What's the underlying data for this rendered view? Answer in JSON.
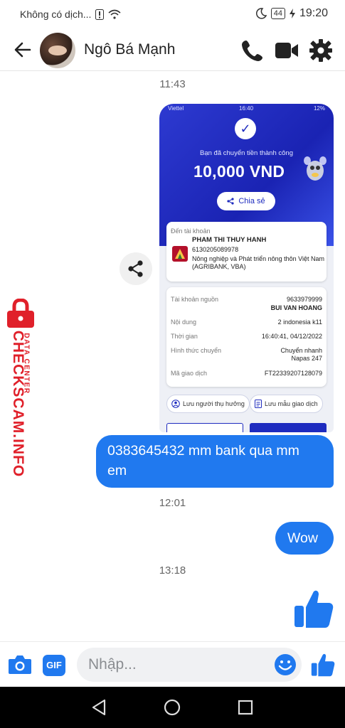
{
  "status_bar": {
    "network_text": "Không có dịch...",
    "battery": "44",
    "clock": "19:20"
  },
  "header": {
    "contact_name": "Ngô Bá Mạnh"
  },
  "timestamps": [
    "11:43",
    "12:01",
    "13:18"
  ],
  "shared_image": {
    "status_bar": {
      "carrier": "Viettel",
      "time": "16:40",
      "battery": "12%"
    },
    "success_message": "Bạn đã chuyển tiền thành công",
    "amount": "10,000 VND",
    "share_label": "Chia sẻ",
    "to_account_label": "Đến tài khoản",
    "recipient_name": "PHAM THI THUY HANH",
    "recipient_account": "6130205089978",
    "recipient_bank": "Nông nghiệp và Phát triển nông thôn Việt Nam (AGRIBANK, VBA)",
    "details": [
      {
        "key": "Tài khoản nguồn",
        "value": "9633979999",
        "value2": "BUI VAN HOANG"
      },
      {
        "key": "Nội dung",
        "value": "2 indonesia k11"
      },
      {
        "key": "Thời gian",
        "value": "16:40:41, 04/12/2022"
      },
      {
        "key": "Hình thức chuyển",
        "value": "Chuyển nhanh Napas 247"
      },
      {
        "key": "Mã giao dịch",
        "value": "FT22339207128079"
      }
    ],
    "save_recipient_label": "Lưu người thụ hưởng",
    "save_template_label": "Lưu mẫu giao dịch"
  },
  "messages": [
    {
      "text": "0383645432 mm bank qua mm em"
    },
    {
      "text": "Wow"
    }
  ],
  "composer": {
    "placeholder": "Nhập..."
  },
  "watermark": {
    "main": "CHECKSCAM.INFO",
    "sub": "DATA CENTER"
  },
  "colors": {
    "accent": "#2079ef",
    "bank_blue": "#1e2bbf",
    "watermark_red": "#e0202a"
  }
}
